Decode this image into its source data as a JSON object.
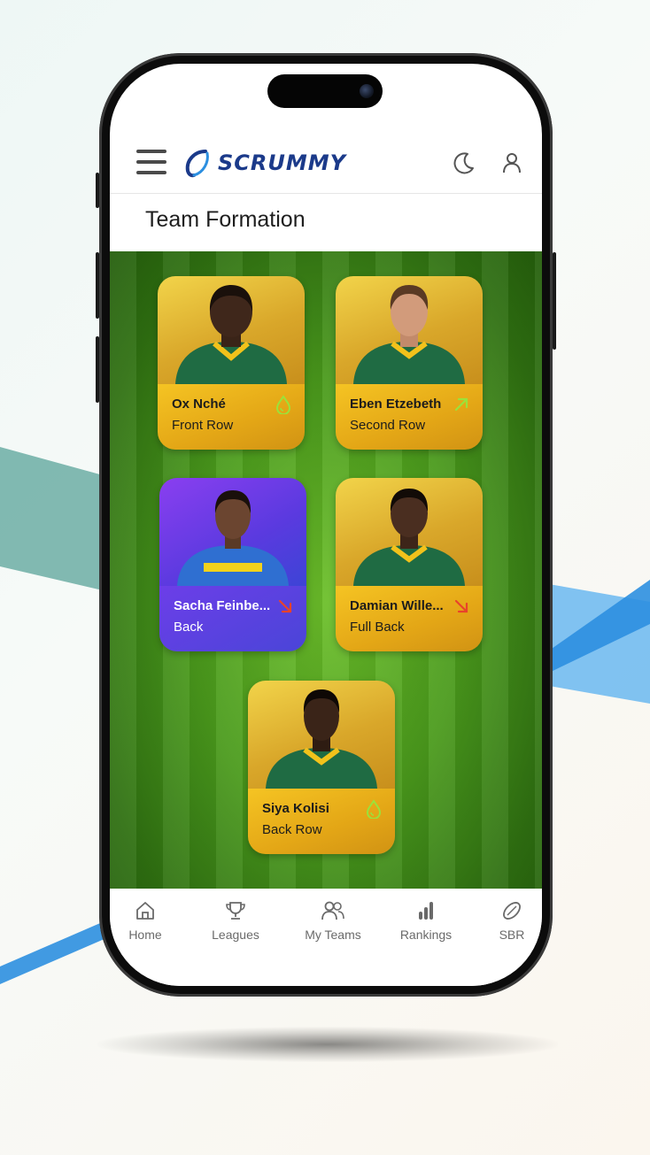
{
  "header": {
    "logo_text": "SCRUMMY"
  },
  "page": {
    "title": "Team Formation"
  },
  "players": [
    {
      "name": "Ox Nché",
      "position": "Front Row",
      "badge": "drop-icon",
      "theme": "gold"
    },
    {
      "name": "Eben Etzebeth",
      "position": "Second Row",
      "badge": "arrow-up-right-icon",
      "theme": "gold"
    },
    {
      "name": "Sacha Feinbe...",
      "position": "Back",
      "badge": "arrow-down-right-icon",
      "theme": "purple"
    },
    {
      "name": "Damian Wille...",
      "position": "Full Back",
      "badge": "arrow-down-right-icon",
      "theme": "gold"
    },
    {
      "name": "Siya Kolisi",
      "position": "Back Row",
      "badge": "drop-icon",
      "theme": "gold"
    }
  ],
  "nav": {
    "items": [
      {
        "label": "Home",
        "icon": "home-icon"
      },
      {
        "label": "Leagues",
        "icon": "trophy-icon"
      },
      {
        "label": "My Teams",
        "icon": "users-icon"
      },
      {
        "label": "Rankings",
        "icon": "bar-chart-icon"
      },
      {
        "label": "SBR",
        "icon": "rugby-ball-icon"
      }
    ]
  },
  "colors": {
    "brand": "#1b3a8a",
    "gold": "#e3a616",
    "purple": "#5a3adf",
    "pitch": "#4a9a1c",
    "trend_up": "#9be23a",
    "trend_down": "#e8432a"
  }
}
